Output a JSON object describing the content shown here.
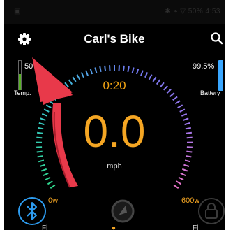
{
  "status_bar": {
    "left": "▣",
    "right": "✱ ⌁ ▽ 50% 4:53"
  },
  "app_bar": {
    "title": "Carl's Bike",
    "settings_icon": "gear-icon",
    "search_icon": "search-icon"
  },
  "temp": {
    "value": "50",
    "label": "Temp."
  },
  "battery": {
    "value": "99.5%",
    "label": "Battery",
    "level": 0.995
  },
  "gauge": {
    "time": "0:20",
    "speed": "0.0",
    "unit": "mph",
    "min_power": "0w",
    "max_power": "600w"
  },
  "bottom_bar": {
    "bluetooth_icon": "bluetooth-icon",
    "navigation_icon": "navigation-icon",
    "lock_icon": "lock-icon",
    "left_text": "Fl",
    "center_text": "●",
    "right_text": "Fl"
  },
  "colors": {
    "accent": "#f5a623",
    "battery_bar": "#3aa7ff",
    "temp_bar": "#58b026",
    "annotation_arrow": "#e8394a"
  }
}
